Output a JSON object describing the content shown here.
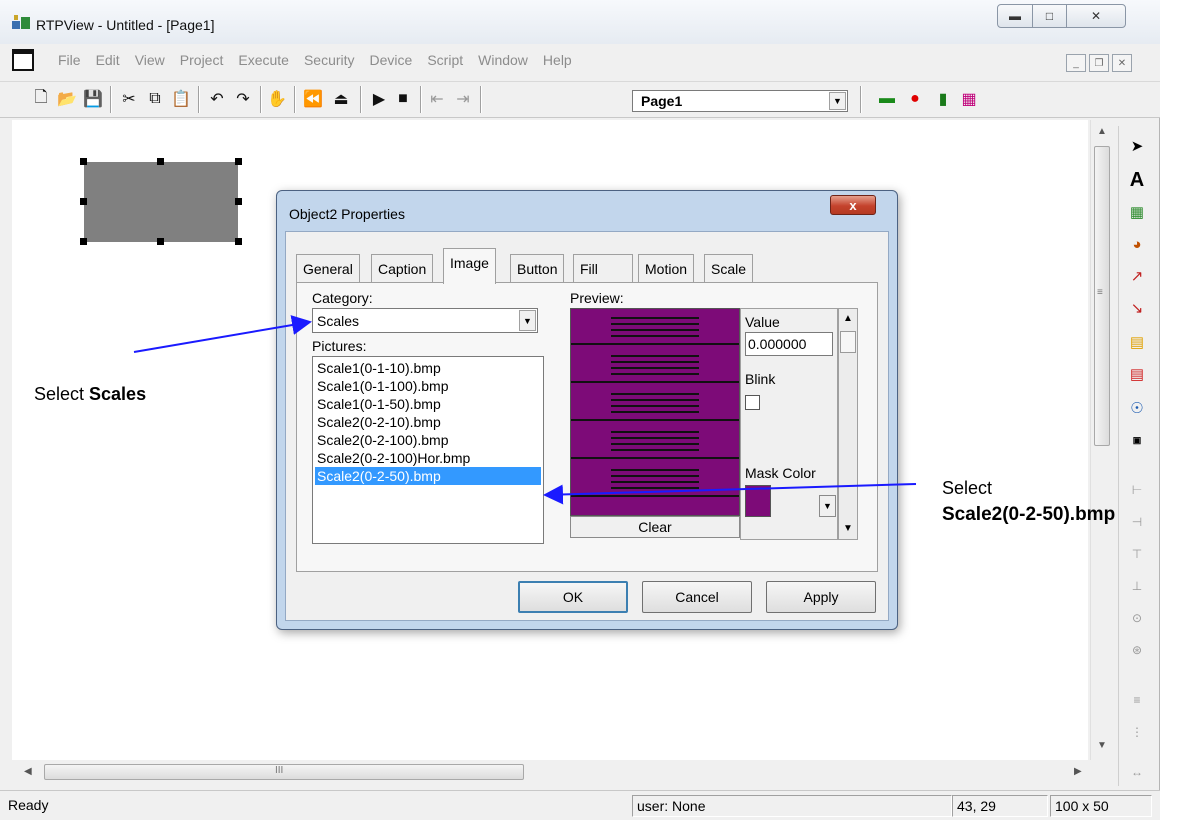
{
  "window": {
    "title": "RTPView  -  Untitled - [Page1]"
  },
  "menu": {
    "items": [
      "File",
      "Edit",
      "View",
      "Project",
      "Execute",
      "Security",
      "Device",
      "Script",
      "Window",
      "Help"
    ]
  },
  "toolbar": {
    "page_select_value": "Page1"
  },
  "canvas": {
    "vscroll_grip": "≡",
    "hscroll_grip": "III"
  },
  "dialog": {
    "title": "Object2 Properties",
    "close_label": "x",
    "tabs": [
      "General",
      "Caption",
      "Image",
      "Button",
      "Fill",
      "Motion",
      "Scale"
    ],
    "active_tab": "Image",
    "category_label": "Category:",
    "category_value": "Scales",
    "pictures_label": "Pictures:",
    "pictures": [
      "Scale1(0-1-10).bmp",
      "Scale1(0-1-100).bmp",
      "Scale1(0-1-50).bmp",
      "Scale2(0-2-10).bmp",
      "Scale2(0-2-100).bmp",
      "Scale2(0-2-100)Hor.bmp",
      "Scale2(0-2-50).bmp"
    ],
    "selected_picture": "Scale2(0-2-50).bmp",
    "preview_label": "Preview:",
    "clear_label": "Clear",
    "value_label": "Value",
    "value": "0.000000",
    "blink_label": "Blink",
    "blink_checked": false,
    "mask_color_label": "Mask Color",
    "mask_color": "#7d0b78",
    "ok_label": "OK",
    "cancel_label": "Cancel",
    "apply_label": "Apply"
  },
  "annotations": {
    "left_prefix": "Select ",
    "left_bold": "Scales",
    "right_prefix": "Select",
    "right_bold": "Scale2(0-2-50).bmp"
  },
  "status": {
    "text": "Ready",
    "user": "user: None",
    "position": "43, 29",
    "size": "100 x 50"
  },
  "colors": {
    "selection": "#3399ff",
    "arrow": "#1a1aff",
    "preview_fill": "#7d0b78"
  }
}
